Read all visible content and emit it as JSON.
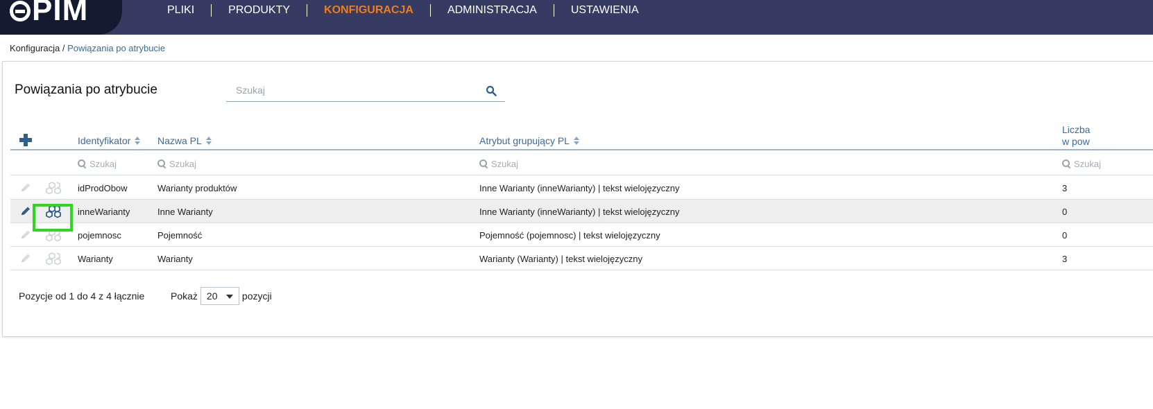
{
  "app": {
    "logo": "PIM"
  },
  "nav": {
    "items": [
      {
        "label": "PLIKI",
        "active": false
      },
      {
        "label": "PRODUKTY",
        "active": false
      },
      {
        "label": "KONFIGURACJA",
        "active": true
      },
      {
        "label": "ADMINISTRACJA",
        "active": false
      },
      {
        "label": "USTAWIENIA",
        "active": false
      }
    ]
  },
  "breadcrumb": {
    "parent": "Konfiguracja",
    "separator": " / ",
    "current": "Powiązania po atrybucie"
  },
  "page": {
    "title": "Powiązania po atrybucie",
    "search_placeholder": "Szukaj"
  },
  "table": {
    "columns": {
      "identyfikator": "Identyfikator",
      "nazwa": "Nazwa PL",
      "atrybut": "Atrybut grupujący PL",
      "liczba_line1": "Liczba",
      "liczba_line2": "w pow"
    },
    "filter_placeholder": "Szukaj",
    "rows": [
      {
        "id": "idProdObow",
        "nazwa": "Warianty produktów",
        "atrybut": "Inne Warianty (inneWarianty) | tekst wielojęzyczny",
        "liczba": "3",
        "highlighted": false
      },
      {
        "id": "inneWarianty",
        "nazwa": "Inne Warianty",
        "atrybut": "Inne Warianty (inneWarianty) | tekst wielojęzyczny",
        "liczba": "0",
        "highlighted": true
      },
      {
        "id": "pojemnosc",
        "nazwa": "Pojemność",
        "atrybut": "Pojemność (pojemnosc) | tekst wielojęzyczny",
        "liczba": "0",
        "highlighted": false
      },
      {
        "id": "Warianty",
        "nazwa": "Warianty",
        "atrybut": "Warianty (Warianty) | tekst wielojęzyczny",
        "liczba": "3",
        "highlighted": false
      }
    ]
  },
  "footer": {
    "info": "Pozycje od 1 do 4 z 4 łącznie",
    "show_label": "Pokaż",
    "page_size": "20",
    "suffix": "pozycji"
  },
  "colors": {
    "nav_bg": "#353b63",
    "logo_bg": "#141a30",
    "active_nav": "#f07c1c",
    "link_blue": "#3a6a9a",
    "highlight_border": "#2fd81f"
  }
}
